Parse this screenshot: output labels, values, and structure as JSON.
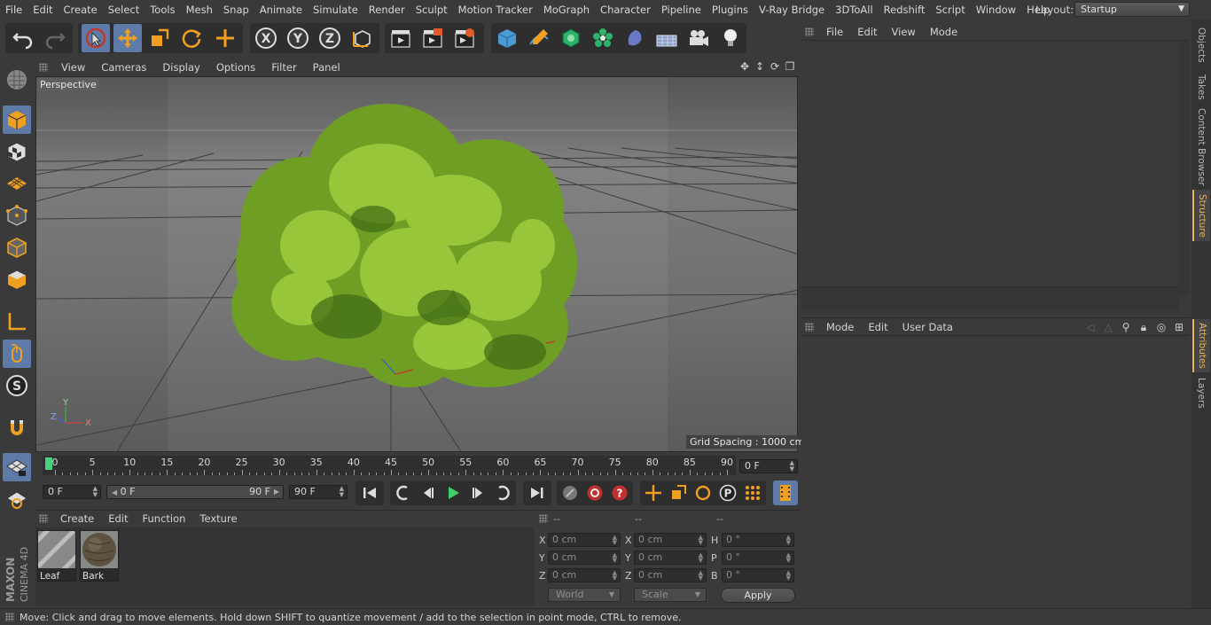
{
  "menubar": {
    "items": [
      "File",
      "Edit",
      "Create",
      "Select",
      "Tools",
      "Mesh",
      "Snap",
      "Animate",
      "Simulate",
      "Render",
      "Sculpt",
      "Motion Tracker",
      "MoGraph",
      "Character",
      "Pipeline",
      "Plugins",
      "V-Ray Bridge",
      "3DToAll",
      "Redshift",
      "Script",
      "Window",
      "Help"
    ],
    "layout_label": "Layout:",
    "layout_value": "Startup"
  },
  "viewport": {
    "menu": [
      "View",
      "Cameras",
      "Display",
      "Options",
      "Filter",
      "Panel"
    ],
    "label": "Perspective",
    "grid_spacing": "Grid Spacing : 1000 cm",
    "axis": {
      "x": "X",
      "y": "Y",
      "z": "Z"
    }
  },
  "timeline": {
    "ticks": [
      "0",
      "5",
      "10",
      "15",
      "20",
      "25",
      "30",
      "35",
      "40",
      "45",
      "50",
      "55",
      "60",
      "65",
      "70",
      "75",
      "80",
      "85",
      "90"
    ],
    "current_frame_right": "0 F",
    "start_field": "0 F",
    "range_start": "0 F",
    "range_end": "90 F",
    "end_field": "90 F"
  },
  "materials": {
    "menu": [
      "Create",
      "Edit",
      "Function",
      "Texture"
    ],
    "items": [
      {
        "name": "Leaf"
      },
      {
        "name": "Bark"
      }
    ]
  },
  "coords": {
    "headers": [
      "--",
      "--",
      "--"
    ],
    "pos": [
      {
        "label": "X",
        "value": "0 cm"
      },
      {
        "label": "Y",
        "value": "0 cm"
      },
      {
        "label": "Z",
        "value": "0 cm"
      }
    ],
    "size": [
      {
        "label": "X",
        "value": "0 cm"
      },
      {
        "label": "Y",
        "value": "0 cm"
      },
      {
        "label": "Z",
        "value": "0 cm"
      }
    ],
    "rot": [
      {
        "label": "H",
        "value": "0 °"
      },
      {
        "label": "P",
        "value": "0 °"
      },
      {
        "label": "B",
        "value": "0 °"
      }
    ],
    "mode": "World",
    "scale": "Scale",
    "apply": "Apply"
  },
  "objects_panel": {
    "menu": [
      "File",
      "Edit",
      "View",
      "Mode"
    ]
  },
  "attributes_panel": {
    "menu": [
      "Mode",
      "Edit",
      "User Data"
    ]
  },
  "vertical_tabs": {
    "top": [
      "Objects",
      "Takes",
      "Content Browser",
      "Structure"
    ],
    "bottom": [
      "Attributes",
      "Layers"
    ]
  },
  "status": "Move: Click and drag to move elements. Hold down SHIFT to quantize movement / add to the selection in point mode, CTRL to remove.",
  "logo": {
    "line1": "MAXON",
    "line2": "CINEMA 4D"
  },
  "colors": {
    "accent_blue": "#5e7aa6",
    "playhead": "#49d27b",
    "active_tab": "#e6b35a",
    "foliage": "#7fb32f"
  }
}
